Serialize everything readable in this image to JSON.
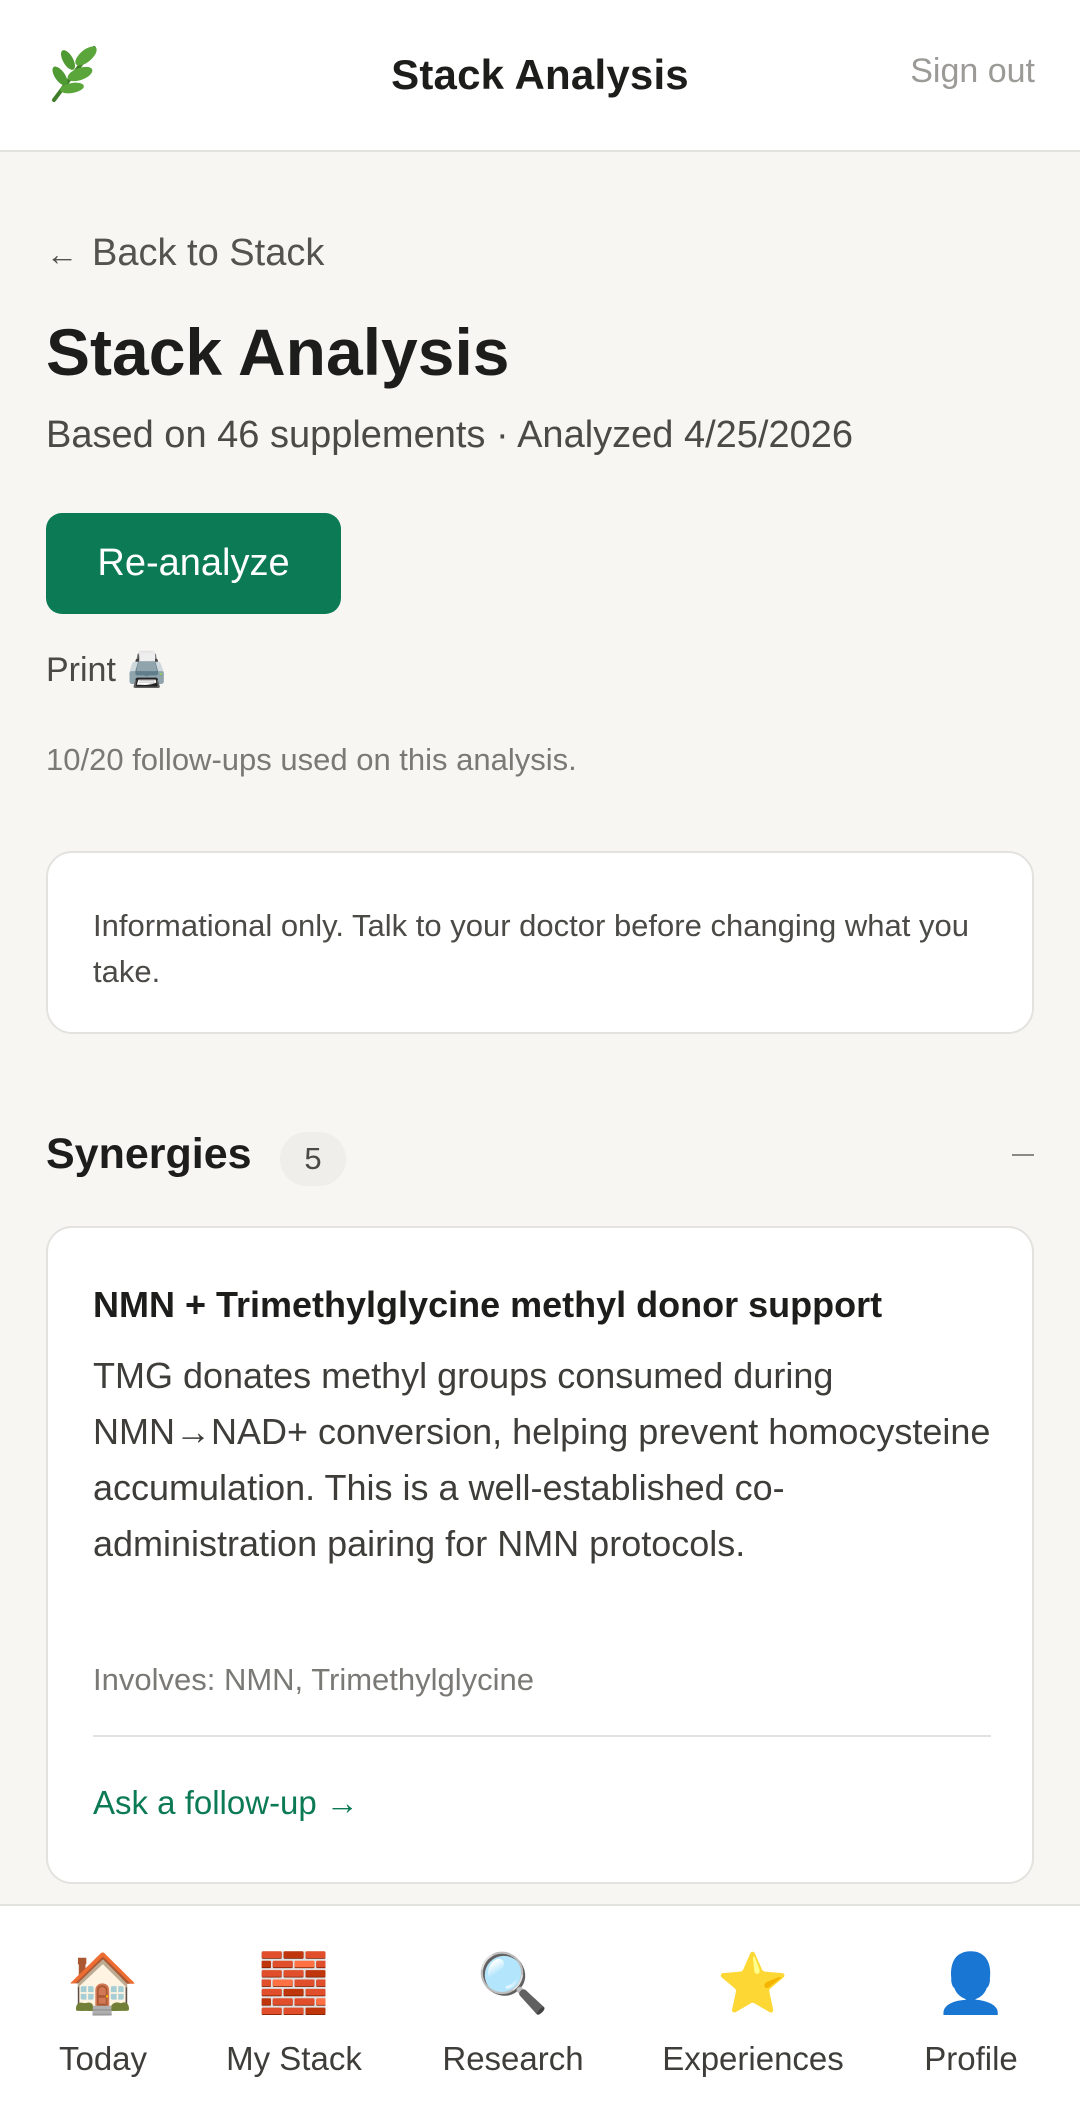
{
  "header": {
    "title": "Stack Analysis",
    "sign_out": "Sign out",
    "logo_icon": "leaf-icon"
  },
  "main": {
    "back_label": "Back to Stack",
    "back_arrow": "←",
    "title": "Stack Analysis",
    "subtitle": "Based on 46 supplements · Analyzed 4/25/2026",
    "reanalyze_label": "Re-analyze",
    "print_label": "Print",
    "print_icon": "🖨️",
    "followups_note": "10/20 follow-ups used on this analysis.",
    "disclaimer": "Informational only. Talk to your doctor before changing what you take."
  },
  "synergies": {
    "title": "Synergies",
    "count": "5",
    "collapse_icon": "minus-icon",
    "cards": [
      {
        "title": "NMN + Trimethylglycine methyl donor support",
        "body": "TMG donates methyl groups consumed during NMN→NAD+ conversion, helping prevent homocysteine accumulation. This is a well-established co-administration pairing for NMN protocols.",
        "involves": "Involves: NMN, Trimethylglycine",
        "followup": "Ask a follow-up →"
      }
    ]
  },
  "nav": {
    "items": [
      {
        "label": "Today",
        "icon": "🏠"
      },
      {
        "label": "My Stack",
        "icon": "🧱"
      },
      {
        "label": "Research",
        "icon": "🔍"
      },
      {
        "label": "Experiences",
        "icon": "⭐"
      },
      {
        "label": "Profile",
        "icon": "👤"
      }
    ]
  },
  "colors": {
    "accent": "#0b7a55",
    "background": "#f7f6f3",
    "card": "#ffffff",
    "border": "#e3e2de"
  }
}
